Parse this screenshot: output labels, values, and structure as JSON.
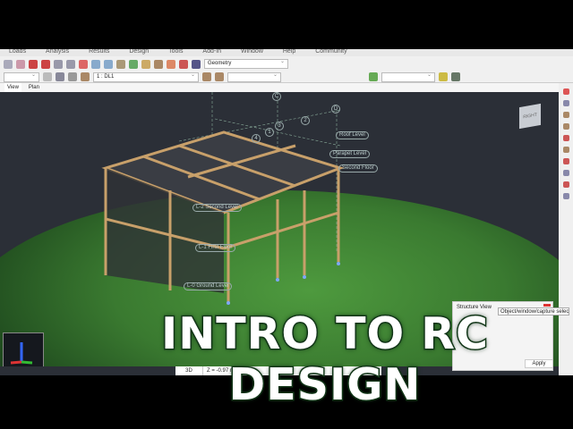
{
  "menu": [
    "Loads",
    "Analysis",
    "Results",
    "Design",
    "Tools",
    "Add-In",
    "Window",
    "Help",
    "Community"
  ],
  "toolbar": {
    "view_select": "Geometry",
    "load_case": "1 : DL1"
  },
  "tabs": [
    "View",
    "Plan"
  ],
  "viewport": {
    "grid_labels": [
      "Roof Level",
      "Parapet Level",
      "Second Floor",
      "L-2 Second Level",
      "L-1 First Floor",
      "L-0 Ground Level"
    ],
    "grid_bubbles": [
      "C",
      "2",
      "3",
      "1",
      "4",
      "D"
    ],
    "nav_cube": "RIGHT"
  },
  "status": {
    "view_mode": "3D",
    "coordinate": "Z = -0.97 m"
  },
  "structure_view": {
    "title": "Structure View",
    "tooltip": "Object/window/capture selection",
    "apply": "Apply"
  },
  "headline": "INTRO TO RC DESIGN"
}
